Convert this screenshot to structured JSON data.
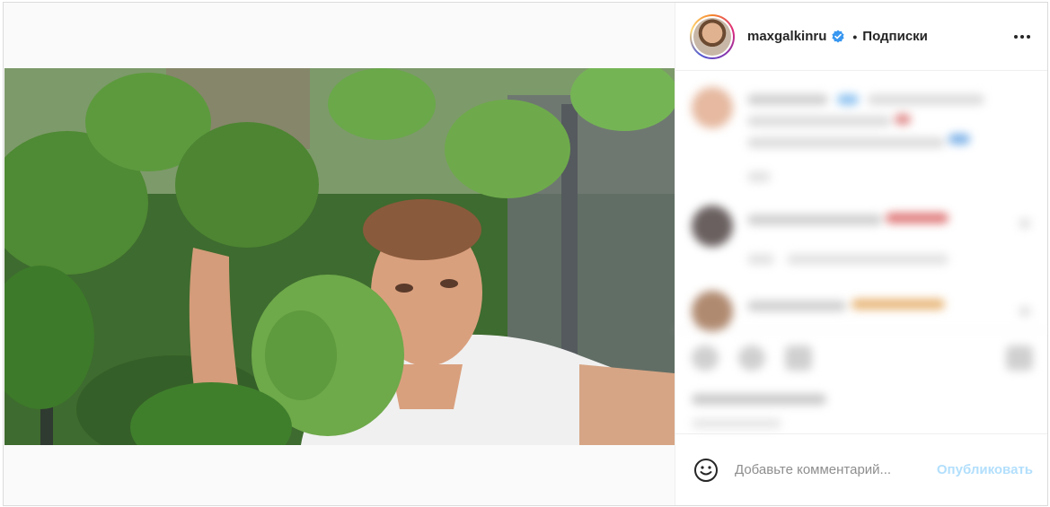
{
  "header": {
    "username": "maxgalkinru",
    "separator": "•",
    "follow_label": "Подписки",
    "verified_icon": "verified-badge-icon",
    "more_icon": "more-options-icon"
  },
  "comment_box": {
    "placeholder": "Добавьте комментарий...",
    "publish_label": "Опубликовать",
    "emoji_icon": "smiley-icon"
  },
  "colors": {
    "verified": "#3897f0",
    "publish_disabled": "#b2dffc",
    "border": "#dbdbdb"
  }
}
